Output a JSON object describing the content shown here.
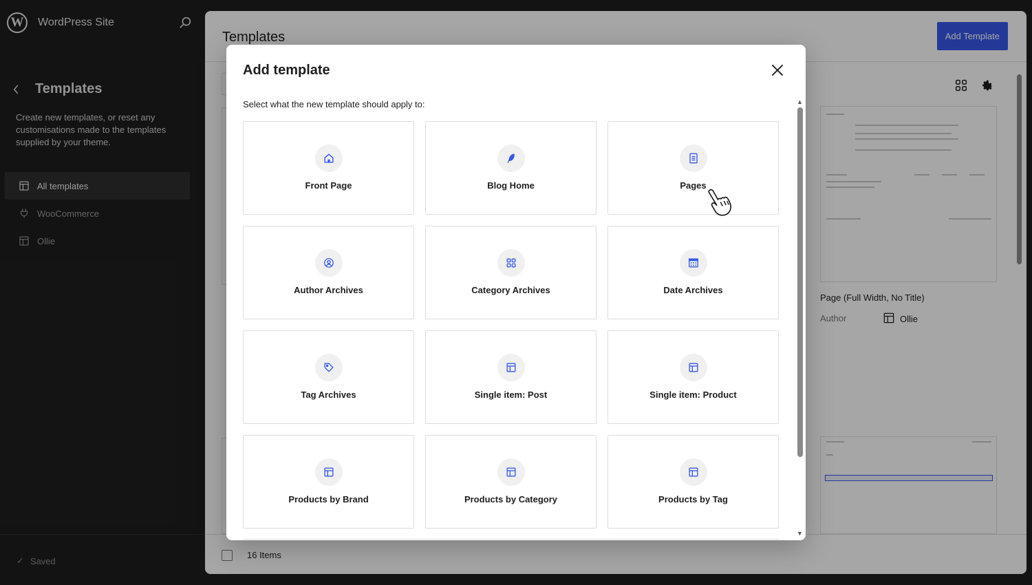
{
  "site": {
    "title": "WordPress Site"
  },
  "sidebar": {
    "title": "Templates",
    "description": "Create new templates, or reset any customisations made to the templates supplied by your theme.",
    "items": [
      {
        "label": "All templates",
        "icon": "layout-icon",
        "active": true
      },
      {
        "label": "WooCommerce",
        "icon": "plug-icon",
        "active": false
      },
      {
        "label": "Ollie",
        "icon": "layout-icon",
        "active": false
      }
    ],
    "status": "Saved"
  },
  "main": {
    "title": "Templates",
    "add_button": "Add Template",
    "card": {
      "title": "Page (Full Width, No Title)",
      "author_label": "Author",
      "author": "Ollie"
    },
    "footer": {
      "count": "16 Items"
    }
  },
  "modal": {
    "title": "Add template",
    "subtitle": "Select what the new template should apply to:",
    "options": [
      {
        "label": "Front Page",
        "icon": "home-icon"
      },
      {
        "label": "Blog Home",
        "icon": "feather-icon"
      },
      {
        "label": "Pages",
        "icon": "page-icon"
      },
      {
        "label": "Author Archives",
        "icon": "user-circle-icon"
      },
      {
        "label": "Category Archives",
        "icon": "category-icon"
      },
      {
        "label": "Date Archives",
        "icon": "calendar-icon"
      },
      {
        "label": "Tag Archives",
        "icon": "tag-icon"
      },
      {
        "label": "Single item: Post",
        "icon": "layout-icon"
      },
      {
        "label": "Single item: Product",
        "icon": "layout-icon"
      },
      {
        "label": "Products by Brand",
        "icon": "layout-icon"
      },
      {
        "label": "Products by Category",
        "icon": "layout-icon"
      },
      {
        "label": "Products by Tag",
        "icon": "layout-icon"
      }
    ]
  },
  "colors": {
    "accent": "#3858e9",
    "sidebar_bg": "#1e1e1e",
    "icon_accent": "#3858e9"
  }
}
